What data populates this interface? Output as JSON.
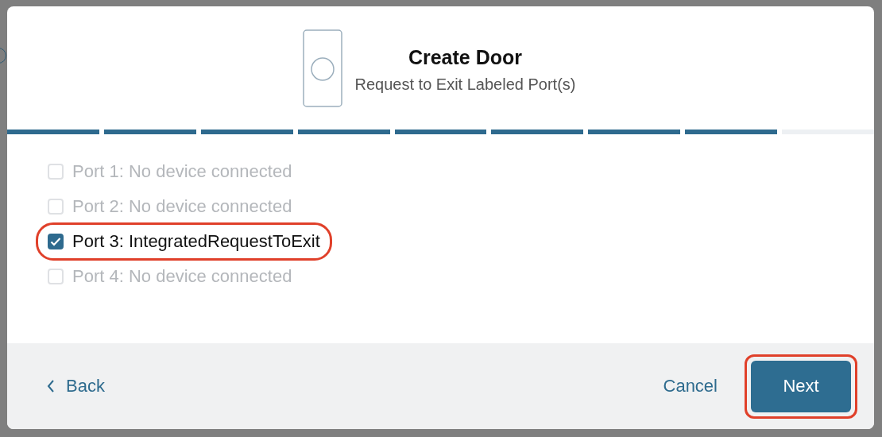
{
  "dialog": {
    "title": "Create Door",
    "subtitle": "Request to Exit Labeled Port(s)"
  },
  "progress": [
    {
      "done": true
    },
    {
      "done": true
    },
    {
      "done": true
    },
    {
      "done": true
    },
    {
      "done": true
    },
    {
      "done": true
    },
    {
      "done": true
    },
    {
      "done": true
    },
    {
      "done": false
    }
  ],
  "ports": [
    {
      "label": "Port 1: No device connected",
      "checked": false,
      "disabled": true,
      "highlighted": false
    },
    {
      "label": "Port 2: No device connected",
      "checked": false,
      "disabled": true,
      "highlighted": false
    },
    {
      "label": "Port 3: IntegratedRequestToExit",
      "checked": true,
      "disabled": false,
      "highlighted": true
    },
    {
      "label": "Port 4: No device connected",
      "checked": false,
      "disabled": true,
      "highlighted": false
    }
  ],
  "footer": {
    "back": {
      "label": "Back"
    },
    "cancel": {
      "label": "Cancel"
    },
    "next": {
      "label": "Next",
      "highlighted": true
    }
  }
}
